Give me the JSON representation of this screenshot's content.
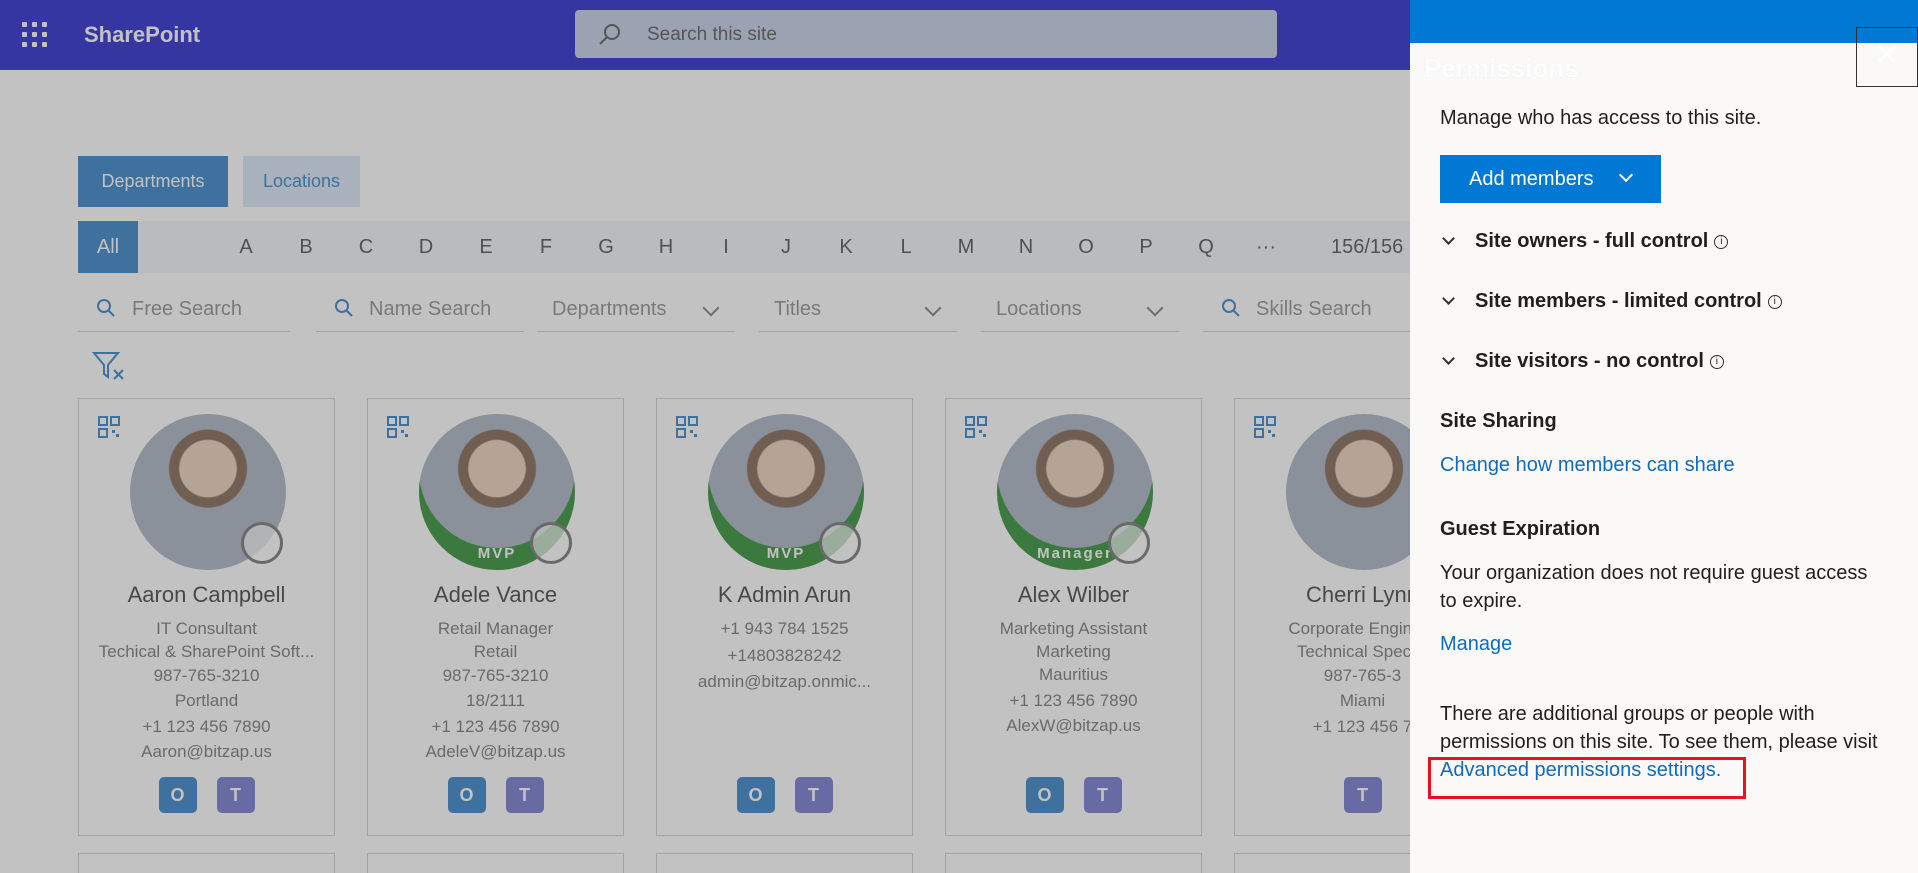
{
  "app": {
    "name": "SharePoint"
  },
  "search": {
    "placeholder": "Search this site"
  },
  "tabs": [
    {
      "label": "Departments",
      "active": true
    },
    {
      "label": "Locations",
      "active": false
    }
  ],
  "alphabet": {
    "items": [
      "All",
      "A",
      "B",
      "C",
      "D",
      "E",
      "F",
      "G",
      "H",
      "I",
      "J",
      "K",
      "L",
      "M",
      "N",
      "O",
      "P",
      "Q",
      "···"
    ],
    "count": "156/156"
  },
  "filters": {
    "free_search": "Free Search",
    "name_search": "Name Search",
    "departments": "Departments",
    "titles": "Titles",
    "locations": "Locations",
    "skills_search": "Skills Search"
  },
  "cards": [
    {
      "name": "Aaron Campbell",
      "badge": "",
      "lines": [
        "IT Consultant",
        "Techical & SharePoint Soft...",
        "987-765-3210",
        "Portland",
        "+1 123 456 7890",
        "Aaron@bitzap.us"
      ]
    },
    {
      "name": "Adele Vance",
      "badge": "MVP",
      "lines": [
        "Retail Manager",
        "Retail",
        "987-765-3210",
        "18/2111",
        "+1 123 456 7890",
        "AdeleV@bitzap.us"
      ]
    },
    {
      "name": "K Admin Arun",
      "badge": "MVP",
      "lines": [
        "+1 943 784 1525",
        "+14803828242",
        "admin@bitzap.onmic..."
      ]
    },
    {
      "name": "Alex Wilber",
      "badge": "Manager",
      "lines": [
        "Marketing Assistant",
        "Marketing",
        "Mauritius",
        "+1 123 456 7890",
        "AlexW@bitzap.us"
      ]
    },
    {
      "name": "Cherri Lynn",
      "badge": "",
      "lines": [
        "Corporate Engineer",
        "Technical Special",
        "987-765-3",
        "Miami",
        "+1 123 456 7"
      ]
    }
  ],
  "panel": {
    "title": "Permissions",
    "close": "✕",
    "intro": "Manage who has access to this site.",
    "add_members": "Add members",
    "groups": [
      "Site owners - full control",
      "Site members - limited control",
      "Site visitors - no control"
    ],
    "site_sharing": {
      "heading": "Site Sharing",
      "link": "Change how members can share"
    },
    "guest_expiration": {
      "heading": "Guest Expiration",
      "text_line1": "Your organization does not require guest access",
      "text_line2": "to expire.",
      "link": "Manage"
    },
    "additional": {
      "line1": "There are additional groups or people with",
      "line2": "permissions on this site. To see them, please visit",
      "link": "Advanced permissions settings."
    }
  },
  "colors": {
    "topbar": "#0000c6",
    "accent": "#0078d4",
    "link": "#0f6cbd",
    "highlight": "#e81123"
  }
}
